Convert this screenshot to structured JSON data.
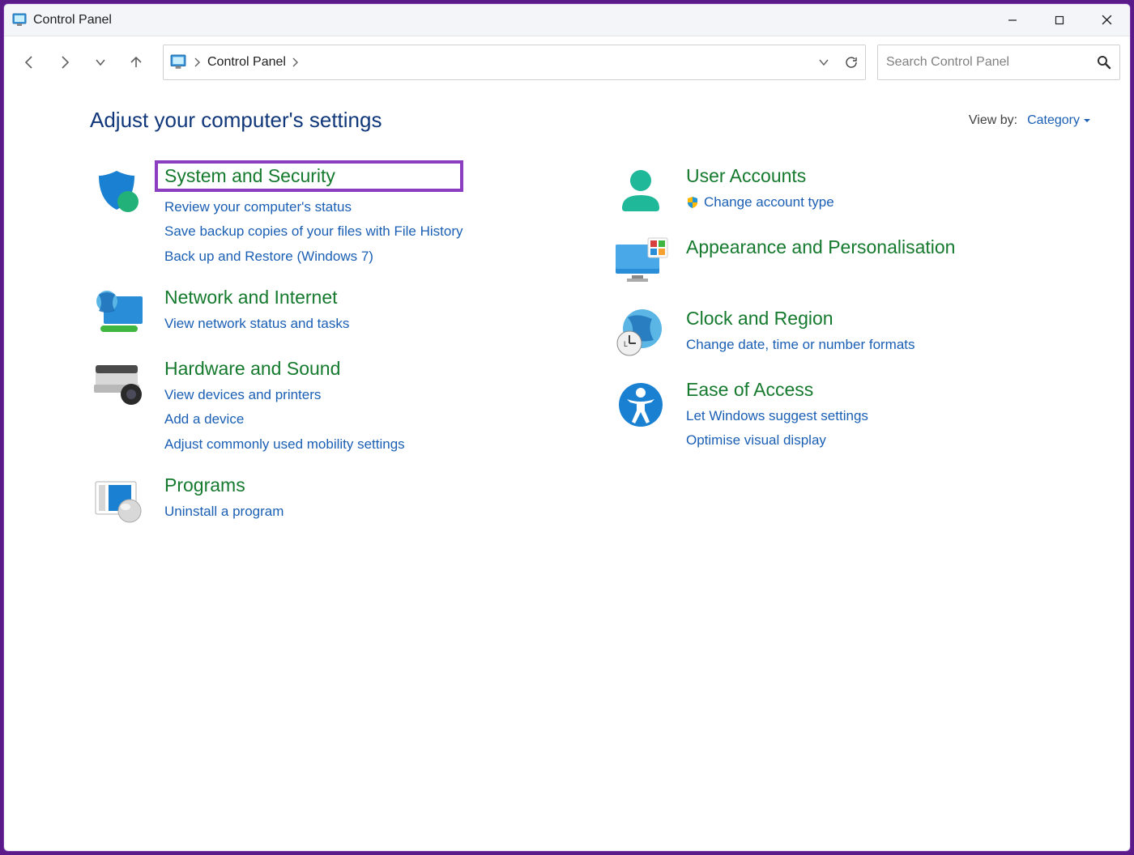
{
  "window": {
    "title": "Control Panel"
  },
  "breadcrumb": {
    "current": "Control Panel"
  },
  "search": {
    "placeholder": "Search Control Panel"
  },
  "heading": "Adjust your computer's settings",
  "view_by": {
    "label": "View by:",
    "value": "Category"
  },
  "left_categories": [
    {
      "title": "System and Security",
      "highlighted": true,
      "sublinks": [
        "Review your computer's status",
        "Save backup copies of your files with File History",
        "Back up and Restore (Windows 7)"
      ]
    },
    {
      "title": "Network and Internet",
      "sublinks": [
        "View network status and tasks"
      ]
    },
    {
      "title": "Hardware and Sound",
      "sublinks": [
        "View devices and printers",
        "Add a device",
        "Adjust commonly used mobility settings"
      ]
    },
    {
      "title": "Programs",
      "sublinks": [
        "Uninstall a program"
      ]
    }
  ],
  "right_categories": [
    {
      "title": "User Accounts",
      "sublinks": [
        "Change account type"
      ],
      "has_shield": true
    },
    {
      "title": "Appearance and Personalisation",
      "sublinks": []
    },
    {
      "title": "Clock and Region",
      "sublinks": [
        "Change date, time or number formats"
      ]
    },
    {
      "title": "Ease of Access",
      "sublinks": [
        "Let Windows suggest settings",
        "Optimise visual display"
      ]
    }
  ]
}
